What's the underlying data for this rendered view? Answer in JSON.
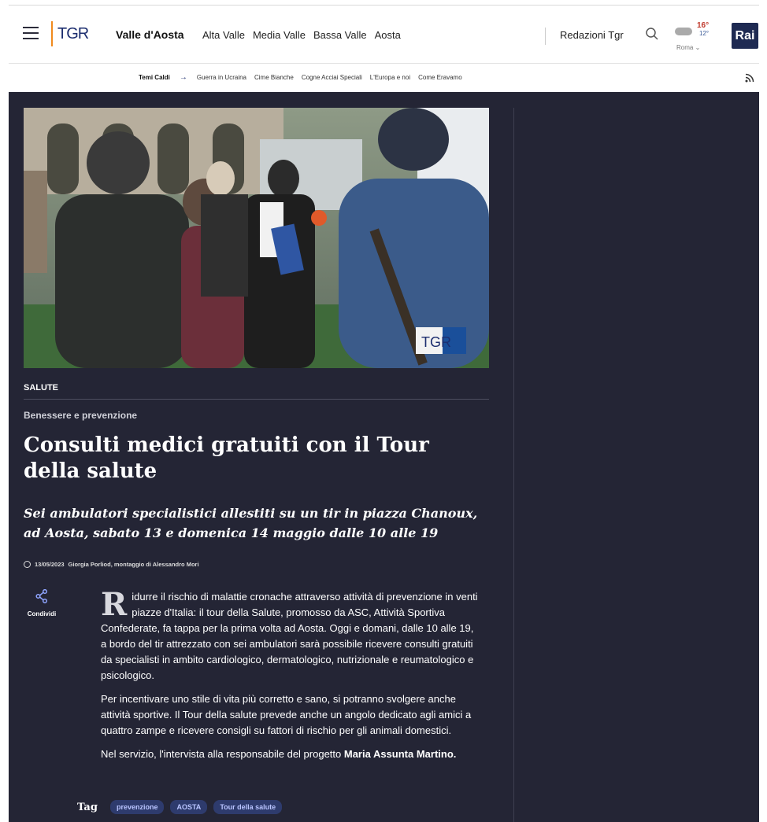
{
  "header": {
    "logo_text": "TGR",
    "region": "Valle d'Aosta",
    "nav": [
      "Alta Valle",
      "Media Valle",
      "Bassa Valle",
      "Aosta"
    ],
    "redazioni": "Redazioni Tgr",
    "weather": {
      "high": "16°",
      "low": "12°",
      "city": "Roma"
    },
    "rai_logo": "Rai",
    "hot_label": "Temi Caldi",
    "hot_topics": [
      "Guerra in Ucraina",
      "Cime Bianche",
      "Cogne Acciai Speciali",
      "L'Europa e noi",
      "Come Eravamo"
    ]
  },
  "article": {
    "category": "SALUTE",
    "kicker": "Benessere e prevenzione",
    "title": "Consulti medici gratuiti con il Tour della salute",
    "subtitle": "Sei ambulatori specialistici allestiti su un tir in piazza Chanoux, ad Aosta, sabato 13 e domenica 14 maggio dalle 10 alle 19",
    "date": "13/05/2023",
    "author": "Giorgia Porliod, montaggio di Alessandro Mori",
    "share_label": "Condividi",
    "drop_cap": "R",
    "p1": "idurre il rischio di malattie cronache attraverso attività di prevenzione in venti piazze d'Italia: il tour della Salute, promosso da ASC, Attività Sportiva Confederate, fa tappa per la prima volta ad Aosta. Oggi e domani, dalle 10 alle 19, a bordo del tir attrezzato con sei ambulatori sarà possibile ricevere consulti gratuiti da specialisti in ambito cardiologico, dermatologico, nutrizionale e reumatologico e psicologico.",
    "p2": "Per incentivare uno stile di vita più corretto e sano, si potranno svolgere anche attività sportive. Il Tour della salute prevede anche un angolo dedicato agli amici a quattro zampe e ricevere consigli su fattori di rischio per gli animali domestici.",
    "p3_prefix": "Nel servizio, l'intervista alla responsabile del progetto ",
    "p3_bold": "Maria Assunta Martino.",
    "image_watermark": "TGR",
    "tags_label": "Tag",
    "tags": [
      "prevenzione",
      "AOSTA",
      "Tour della salute"
    ]
  }
}
